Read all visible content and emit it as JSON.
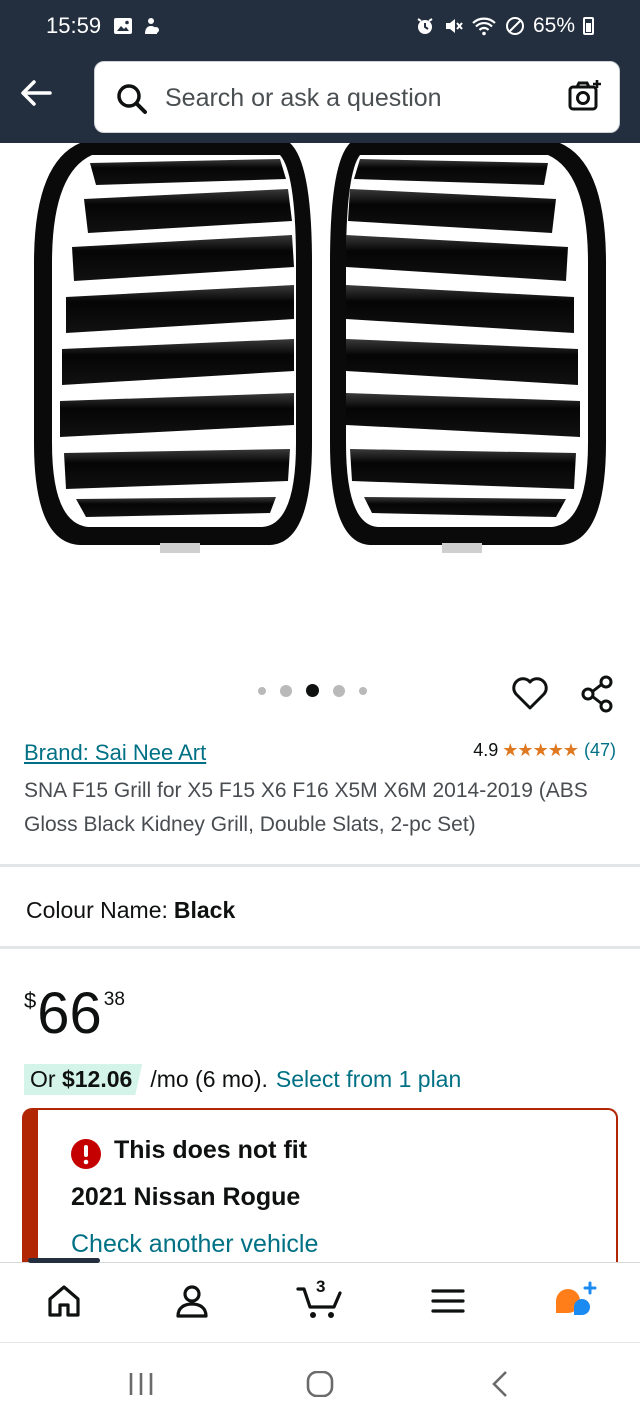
{
  "status_bar": {
    "time": "15:59",
    "battery": "65%"
  },
  "header": {
    "search_placeholder": "Search or ask a question"
  },
  "gallery": {
    "image_count": 5,
    "active_index": 2
  },
  "product": {
    "brand": "Brand: Sai Nee Art",
    "rating": "4.9",
    "stars": "★★★★★",
    "star_value": 4.9,
    "review_count": "(47)",
    "title": "SNA F15 Grill for X5 F15 X6 F16 X5M X6M 2014-2019 (ABS Gloss Black Kidney Grill, Double Slats, 2-pc Set)"
  },
  "variation": {
    "label": "Colour Name:",
    "value": "Black"
  },
  "price": {
    "currency": "$",
    "whole": "66",
    "fraction": "38"
  },
  "installment": {
    "prefix": "Or ",
    "amount": "$12.06",
    "terms": "/mo (6 mo).",
    "link": "Select from 1 plan"
  },
  "fitment": {
    "title": "This does not fit",
    "vehicle": "2021 Nissan Rogue",
    "link": "Check another vehicle"
  },
  "bottom_nav": {
    "cart_count": "3"
  },
  "colors": {
    "header_bg": "#232f3e",
    "link": "#007185",
    "star": "#de7921",
    "alert": "#b12704",
    "installment_bg": "#d4f4ea"
  }
}
